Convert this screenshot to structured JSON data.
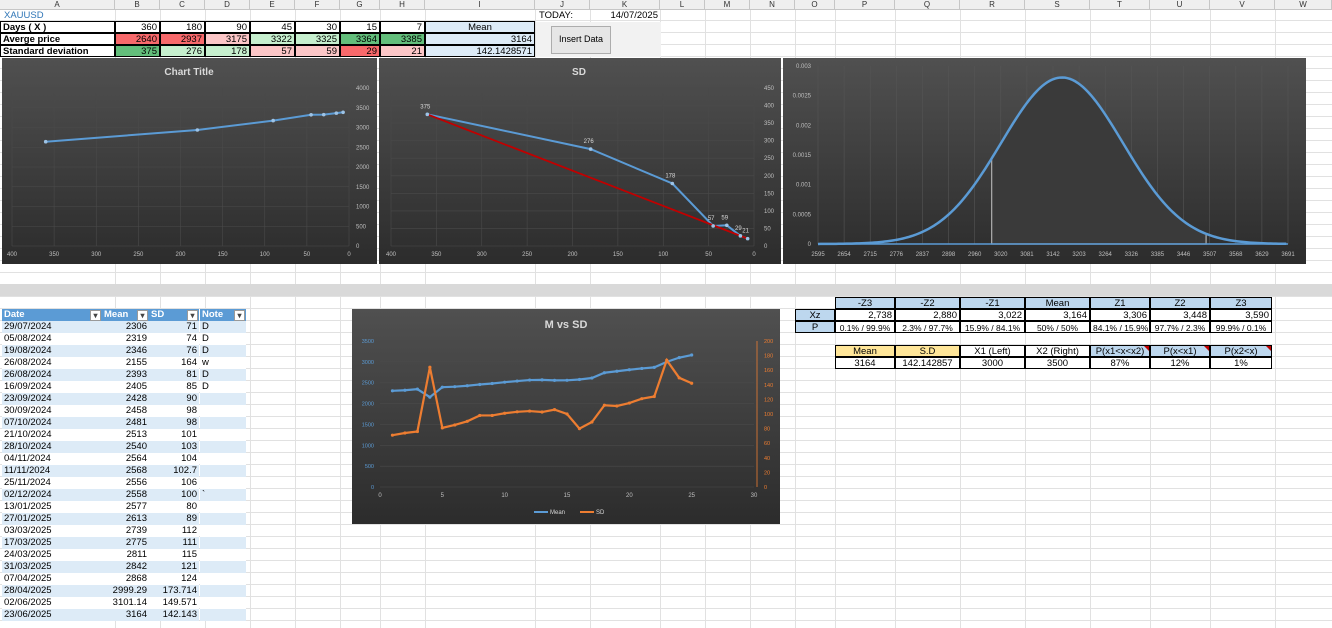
{
  "columns": [
    "A",
    "B",
    "C",
    "D",
    "E",
    "F",
    "G",
    "H",
    "I",
    "J",
    "K",
    "L",
    "M",
    "N",
    "O",
    "P",
    "Q",
    "R",
    "S",
    "T",
    "U",
    "V",
    "W"
  ],
  "top_table": {
    "symbol": "XAUUSD",
    "rows": [
      {
        "label": "Days ( X )",
        "values": [
          "360",
          "180",
          "90",
          "45",
          "30",
          "15",
          "7"
        ],
        "extra": "Mean"
      },
      {
        "label": "Averge price",
        "values": [
          "2640",
          "2937",
          "3175",
          "3322",
          "3325",
          "3364",
          "3385"
        ],
        "extra": "3164"
      },
      {
        "label": "Standard deviation",
        "values": [
          "375",
          "276",
          "178",
          "57",
          "59",
          "29",
          "21"
        ],
        "extra": "142.1428571"
      }
    ],
    "today_label": "TODAY:",
    "today_value": "14/07/2025",
    "insert_button": "Insert Data"
  },
  "colors": {
    "red_cell": "#f8696b",
    "light_red": "#fcc6c7",
    "green_cell": "#63be7b",
    "light_green": "#c6efce",
    "chart_blue": "#5b9bd5",
    "chart_orange": "#ed7d31",
    "chart_red": "#c00000",
    "header_blue": "#5b9bd5"
  },
  "charts": [
    {
      "id": "price-chart",
      "type": "line",
      "title": "Chart Title",
      "x": [
        360,
        180,
        90,
        45,
        30,
        15,
        7
      ],
      "values": [
        2640,
        2937,
        3175,
        3322,
        3325,
        3364,
        3385
      ],
      "xticks": [
        "400",
        "350",
        "300",
        "250",
        "200",
        "150",
        "100",
        "50",
        "0"
      ],
      "yticks": [
        "0",
        "500",
        "1000",
        "1500",
        "2000",
        "2500",
        "3000",
        "3500",
        "4000"
      ],
      "xlim": [
        400,
        0
      ],
      "ylim": [
        0,
        4000
      ]
    },
    {
      "id": "sd-chart",
      "type": "line",
      "title": "SD",
      "x": [
        360,
        180,
        90,
        45,
        30,
        15,
        7
      ],
      "values": [
        375,
        276,
        178,
        57,
        59,
        29,
        21
      ],
      "labels": [
        "375",
        "276",
        "178",
        "57",
        "59",
        "29",
        "21"
      ],
      "trend": [
        [
          360,
          375
        ],
        [
          7,
          21
        ]
      ],
      "xticks": [
        "400",
        "350",
        "300",
        "250",
        "200",
        "150",
        "100",
        "50",
        "0"
      ],
      "yticks": [
        "0",
        "50",
        "100",
        "150",
        "200",
        "250",
        "300",
        "350",
        "400",
        "450"
      ],
      "xlim": [
        400,
        0
      ],
      "ylim": [
        0,
        450
      ]
    },
    {
      "id": "normal-chart",
      "type": "area",
      "xticks": [
        "2595",
        "2654",
        "2715",
        "2776",
        "2837",
        "2898",
        "2960",
        "3020",
        "3081",
        "3142",
        "3203",
        "3264",
        "3326",
        "3385",
        "3446",
        "3507",
        "3568",
        "3629",
        "3691"
      ],
      "yticks": [
        "0",
        "0.0005",
        "0.001",
        "0.0015",
        "0.002",
        "0.0025",
        "0.003"
      ],
      "mean": 3164,
      "sd": 142.142857,
      "x1": 3000,
      "x2": 3500,
      "xlim": [
        2595,
        3691
      ],
      "ylim": [
        0,
        0.003
      ]
    },
    {
      "id": "m-vs-sd-chart",
      "type": "line",
      "title": "M vs SD",
      "x": [
        1,
        2,
        3,
        4,
        5,
        6,
        7,
        8,
        9,
        10,
        11,
        12,
        13,
        14,
        15,
        16,
        17,
        18,
        19,
        20,
        21,
        22,
        23,
        24,
        25
      ],
      "series": [
        {
          "name": "Mean",
          "values": [
            2306,
            2319,
            2346,
            2155,
            2393,
            2405,
            2428,
            2458,
            2481,
            2513,
            2540,
            2564,
            2568,
            2556,
            2558,
            2577,
            2613,
            2739,
            2775,
            2811,
            2842,
            2868,
            2999.29,
            3101.14,
            3164
          ]
        },
        {
          "name": "SD",
          "values": [
            71,
            74,
            76,
            164,
            81,
            85,
            90,
            98,
            98,
            101,
            103,
            104,
            102.7,
            106,
            100,
            80,
            89,
            112,
            111,
            115,
            121,
            124,
            173.714,
            149.571,
            142.143
          ]
        }
      ],
      "xticks": [
        "0",
        "5",
        "10",
        "15",
        "20",
        "25",
        "30"
      ],
      "yticks_left": [
        "0",
        "500",
        "1000",
        "1500",
        "2000",
        "2500",
        "3000",
        "3500"
      ],
      "yticks_right": [
        "0",
        "20",
        "40",
        "60",
        "80",
        "100",
        "120",
        "140",
        "160",
        "180",
        "200"
      ],
      "xlim": [
        0,
        30
      ],
      "ylim_left": [
        0,
        3500
      ],
      "ylim_right": [
        0,
        200
      ]
    }
  ],
  "data_table": {
    "headers": [
      "Date",
      "Mean",
      "SD",
      "Note"
    ],
    "rows": [
      [
        "29/07/2024",
        "2306",
        "71",
        "D"
      ],
      [
        "05/08/2024",
        "2319",
        "74",
        "D"
      ],
      [
        "19/08/2024",
        "2346",
        "76",
        "D"
      ],
      [
        "26/08/2024",
        "2155",
        "164",
        "w"
      ],
      [
        "26/08/2024",
        "2393",
        "81",
        "D"
      ],
      [
        "16/09/2024",
        "2405",
        "85",
        "D"
      ],
      [
        "23/09/2024",
        "2428",
        "90",
        ""
      ],
      [
        "30/09/2024",
        "2458",
        "98",
        ""
      ],
      [
        "07/10/2024",
        "2481",
        "98",
        ""
      ],
      [
        "21/10/2024",
        "2513",
        "101",
        ""
      ],
      [
        "28/10/2024",
        "2540",
        "103",
        ""
      ],
      [
        "04/11/2024",
        "2564",
        "104",
        ""
      ],
      [
        "11/11/2024",
        "2568",
        "102.7",
        ""
      ],
      [
        "25/11/2024",
        "2556",
        "106",
        ""
      ],
      [
        "02/12/2024",
        "2558",
        "100",
        "`"
      ],
      [
        "13/01/2025",
        "2577",
        "80",
        ""
      ],
      [
        "27/01/2025",
        "2613",
        "89",
        ""
      ],
      [
        "03/03/2025",
        "2739",
        "112",
        ""
      ],
      [
        "17/03/2025",
        "2775",
        "111",
        ""
      ],
      [
        "24/03/2025",
        "2811",
        "115",
        ""
      ],
      [
        "31/03/2025",
        "2842",
        "121",
        ""
      ],
      [
        "07/04/2025",
        "2868",
        "124",
        ""
      ],
      [
        "28/04/2025",
        "2999.29",
        "173.714",
        ""
      ],
      [
        "02/06/2025",
        "3101.14",
        "149.571",
        ""
      ],
      [
        "23/06/2025",
        "3164",
        "142.143",
        ""
      ]
    ]
  },
  "z_table": {
    "headers": [
      "-Z3",
      "-Z2",
      "-Z1",
      "Mean",
      "Z1",
      "Z2",
      "Z3"
    ],
    "xz_label": "Xz",
    "xz": [
      "2,738",
      "2,880",
      "3,022",
      "3,164",
      "3,306",
      "3,448",
      "3,590"
    ],
    "p_label": "P",
    "p": [
      "0.1% / 99.9%",
      "2.3% / 97.7%",
      "15.9% / 84.1%",
      "50% / 50%",
      "84.1% / 15.9%",
      "97.7% / 2.3%",
      "99.9% / 0.1%"
    ]
  },
  "prob_table": {
    "headers": [
      "Mean",
      "S.D",
      "X1 (Left)",
      "X2 (Right)",
      "P(x1<x<x2)",
      "P(x<x1)",
      "P(x2<x)"
    ],
    "values": [
      "3164",
      "142.142857",
      "3000",
      "3500",
      "87%",
      "12%",
      "1%"
    ]
  }
}
